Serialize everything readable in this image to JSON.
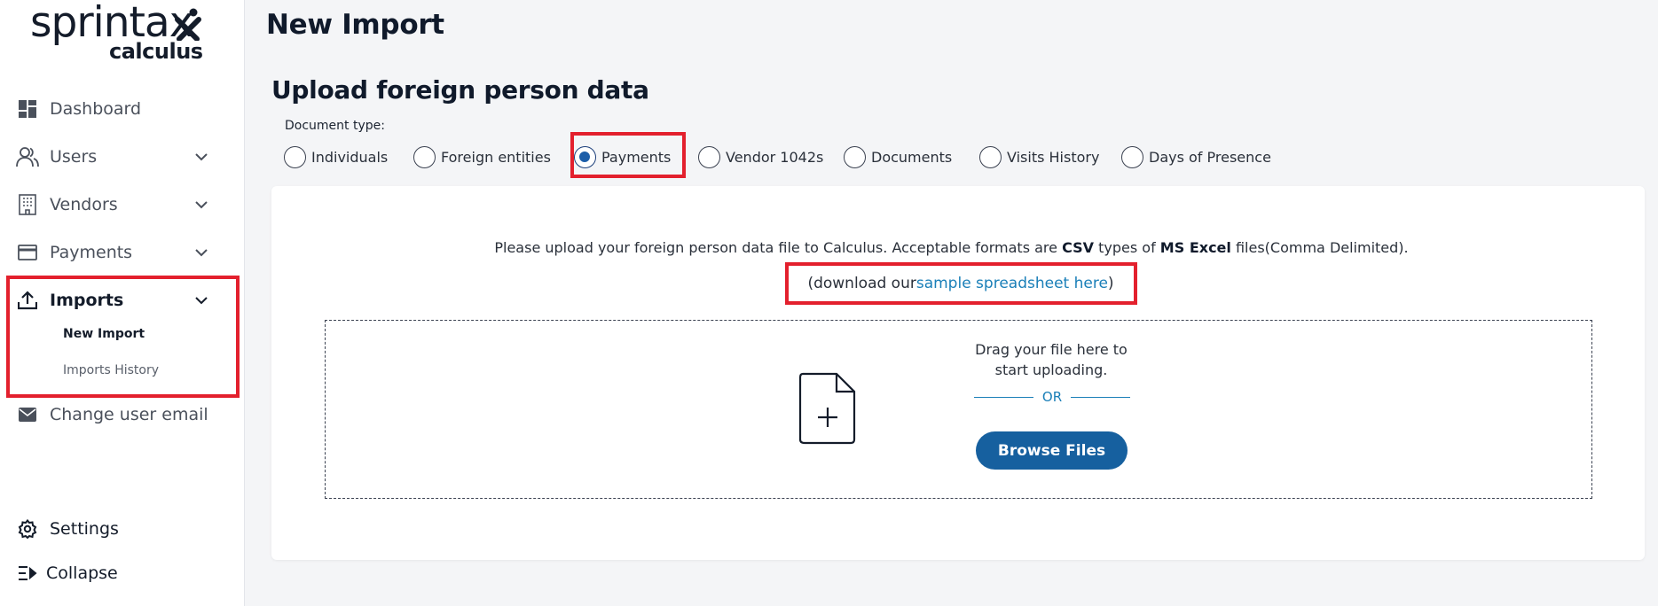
{
  "brand": {
    "name": "sprintax",
    "product": "calculus"
  },
  "sidebar": {
    "items": [
      {
        "label": "Dashboard",
        "icon": "dashboard-icon"
      },
      {
        "label": "Users",
        "icon": "users-icon",
        "expandable": true
      },
      {
        "label": "Vendors",
        "icon": "building-icon",
        "expandable": true
      },
      {
        "label": "Payments",
        "icon": "credit-card-icon",
        "expandable": true
      },
      {
        "label": "Imports",
        "icon": "upload-icon",
        "expandable": true,
        "expanded": true,
        "children": [
          {
            "label": "New Import",
            "active": true
          },
          {
            "label": "Imports History"
          }
        ]
      },
      {
        "label": "Change user email",
        "icon": "envelope-icon"
      }
    ],
    "footer": [
      {
        "label": "Settings",
        "icon": "gear-icon"
      },
      {
        "label": "Collapse",
        "icon": "collapse-icon"
      }
    ]
  },
  "page": {
    "title": "New Import",
    "section_title": "Upload foreign person data",
    "document_type_label": "Document type:",
    "document_types": [
      {
        "label": "Individuals",
        "selected": false
      },
      {
        "label": "Foreign entities",
        "selected": false
      },
      {
        "label": "Payments",
        "selected": true
      },
      {
        "label": "Vendor 1042s",
        "selected": false
      },
      {
        "label": "Documents",
        "selected": false
      },
      {
        "label": "Visits History",
        "selected": false
      },
      {
        "label": "Days of Presence",
        "selected": false
      }
    ]
  },
  "upload": {
    "info_prefix": "Please upload your foreign person data file to Calculus. Acceptable formats are ",
    "info_format": "CSV",
    "info_mid": " types of ",
    "info_app": "MS Excel",
    "info_suffix": " files(Comma Delimited).",
    "download_prefix": "(download our ",
    "download_link": "sample spreadsheet here",
    "download_suffix": ")",
    "drag_text": "Drag your file here to start uploading.",
    "or_text": "OR",
    "browse_label": "Browse Files"
  },
  "colors": {
    "accent": "#16609f",
    "link": "#1a7fb8",
    "highlight": "#e3202d",
    "background": "#f4f5f7"
  }
}
